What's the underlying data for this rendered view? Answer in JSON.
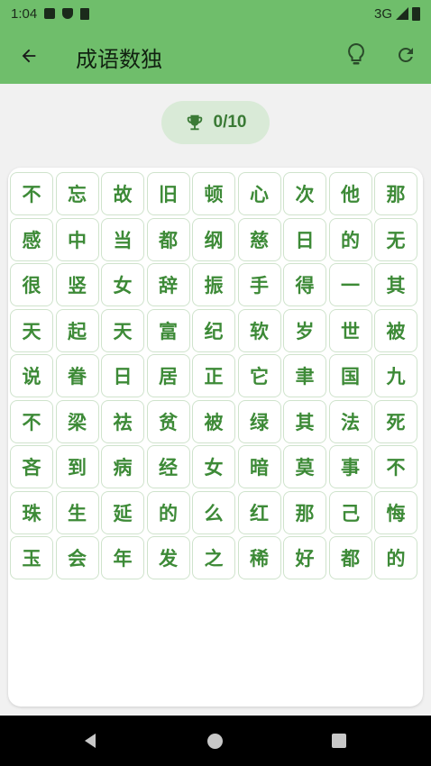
{
  "status_bar": {
    "time": "1:04",
    "network": "3G",
    "left_icons": [
      "app-a-icon",
      "shield-icon",
      "sd-card-icon"
    ],
    "right_icons": [
      "signal-icon",
      "battery-icon"
    ]
  },
  "app_bar": {
    "title": "成语数独",
    "back_icon": "arrow-left-icon",
    "hint_icon": "lightbulb-icon",
    "refresh_icon": "refresh-icon",
    "color": "#6fbe6b"
  },
  "score": {
    "icon": "trophy-icon",
    "text": "0/10"
  },
  "grid": [
    [
      "不",
      "忘",
      "故",
      "旧",
      "顿",
      "心",
      "次",
      "他",
      "那"
    ],
    [
      "感",
      "中",
      "当",
      "都",
      "纲",
      "慈",
      "日",
      "的",
      "无"
    ],
    [
      "很",
      "竖",
      "女",
      "辞",
      "振",
      "手",
      "得",
      "一",
      "其"
    ],
    [
      "天",
      "起",
      "天",
      "富",
      "纪",
      "软",
      "岁",
      "世",
      "被"
    ],
    [
      "说",
      "眷",
      "日",
      "居",
      "正",
      "它",
      "聿",
      "国",
      "九"
    ],
    [
      "不",
      "梁",
      "祛",
      "贫",
      "被",
      "绿",
      "其",
      "法",
      "死"
    ],
    [
      "吝",
      "到",
      "病",
      "经",
      "女",
      "暗",
      "莫",
      "事",
      "不"
    ],
    [
      "珠",
      "生",
      "延",
      "的",
      "么",
      "红",
      "那",
      "己",
      "悔"
    ],
    [
      "玉",
      "会",
      "年",
      "发",
      "之",
      "稀",
      "好",
      "都",
      "的"
    ]
  ],
  "colors": {
    "cell_text": "#3d8a37",
    "cell_border": "#cfe3cc",
    "score_bg": "#d9ead7"
  },
  "nav_bar": {
    "back_icon": "nav-back-icon",
    "home_icon": "nav-home-icon",
    "recent_icon": "nav-recent-icon"
  }
}
